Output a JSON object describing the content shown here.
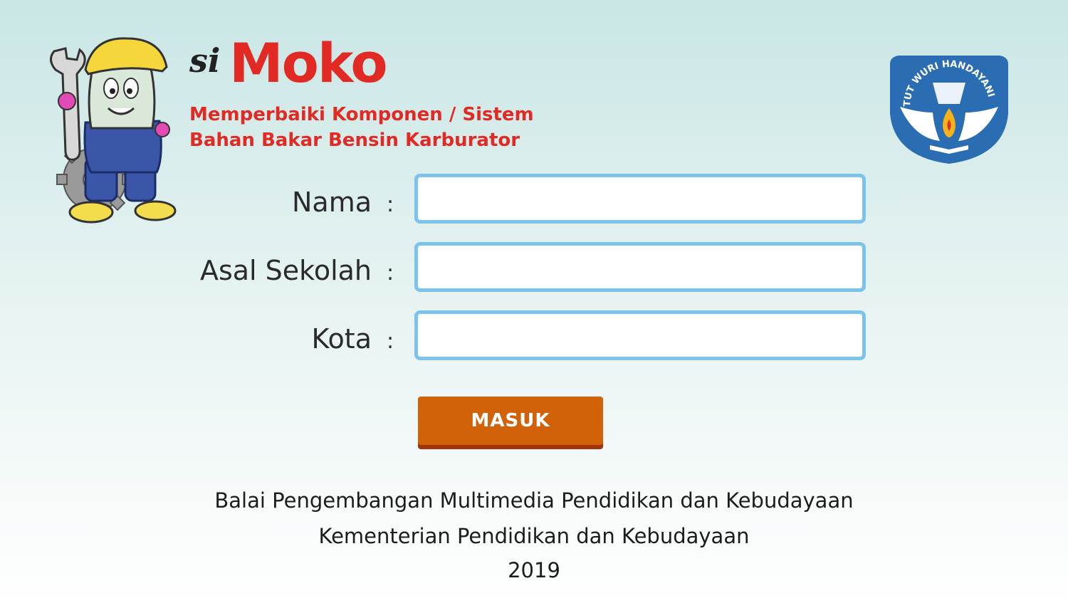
{
  "app": {
    "logo_prefix": "si",
    "logo_name": "Moko",
    "subtitle_line1": "Memperbaiki Komponen / Sistem",
    "subtitle_line2": "Bahan Bakar Bensin Karburator",
    "emblem_text": "TUT WURI HANDAYANI"
  },
  "form": {
    "fields": [
      {
        "label": "Nama",
        "colon": ":",
        "value": "",
        "placeholder": ""
      },
      {
        "label": "Asal Sekolah",
        "colon": ":",
        "value": "",
        "placeholder": ""
      },
      {
        "label": "Kota",
        "colon": ":",
        "value": "",
        "placeholder": ""
      }
    ],
    "submit_label": "MASUK"
  },
  "footer": {
    "line1": "Balai Pengembangan Multimedia Pendidikan dan Kebudayaan",
    "line2": "Kementerian Pendidikan dan Kebudayaan",
    "year": "2019"
  },
  "colors": {
    "brand_red": "#e22a24",
    "field_border": "#7cc2ef",
    "button": "#d1620a",
    "emblem_blue": "#2b6db3"
  }
}
